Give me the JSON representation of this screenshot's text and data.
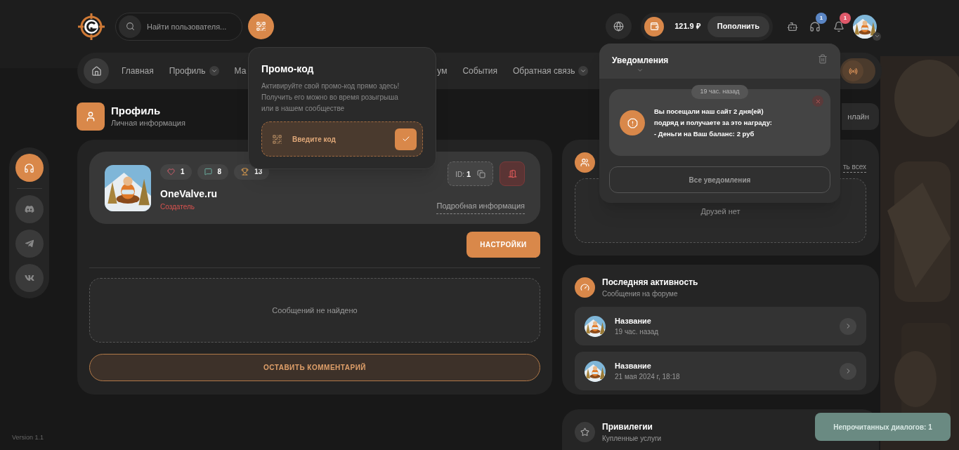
{
  "header": {
    "search": {
      "placeholder": "Найти пользователя..."
    },
    "balance": "121.9 ₽",
    "topup_button": "Пополнить",
    "support_badge": "1",
    "notifications_badge": "1"
  },
  "nav": {
    "items": [
      {
        "label": "Главная",
        "dropdown": false
      },
      {
        "label": "Профиль",
        "dropdown": true
      },
      {
        "label": "Ма",
        "dropdown": false
      },
      {
        "label": "ум",
        "dropdown": false
      },
      {
        "label": "События",
        "dropdown": false
      },
      {
        "label": "Обратная связь",
        "dropdown": true
      }
    ]
  },
  "page_header": {
    "title": "Профиль",
    "subtitle": "Личная информация",
    "online_button": "нлайн"
  },
  "profile": {
    "likes": "1",
    "comments": "8",
    "trophies": "13",
    "name": "OneValve.ru",
    "role": "Создатель",
    "id_label": "ID:",
    "id": "1",
    "details_link": "Подробная информация",
    "settings_button": "НАСТРОЙКИ",
    "empty_messages": "Сообщений не найдено",
    "comment_button": "ОСТАВИТЬ КОММЕНТАРИЙ"
  },
  "friends": {
    "show_all_link": "ть всех",
    "empty": "Друзей нет"
  },
  "activity": {
    "title": "Последняя активность",
    "subtitle": "Сообщения на форуме",
    "items": [
      {
        "title": "Название",
        "time": "19 час. назад"
      },
      {
        "title": "Название",
        "time": "21 мая 2024 г, 18:18"
      }
    ]
  },
  "privileges": {
    "title": "Привилегии",
    "subtitle": "Купленные услуги"
  },
  "promo_popup": {
    "title": "Промо-код",
    "description": "Активируйте свой промо-код прямо здесь!\nПолучить его можно во время розыгрыша\nили в нашем сообществе",
    "code_field": {
      "placeholder": "Введите код"
    }
  },
  "notifications_popup": {
    "title": "Уведомления",
    "items": [
      {
        "time": "19 час. назад",
        "message": "Вы посещали наш сайт 2 дня(ей)\nподряд и получаете за это награду:\n- Деньги на Ваш баланс: 2 руб"
      }
    ],
    "all_button": "Все уведомления"
  },
  "toast": "Непрочитанных диалогов: 1",
  "version": "Version 1.1"
}
